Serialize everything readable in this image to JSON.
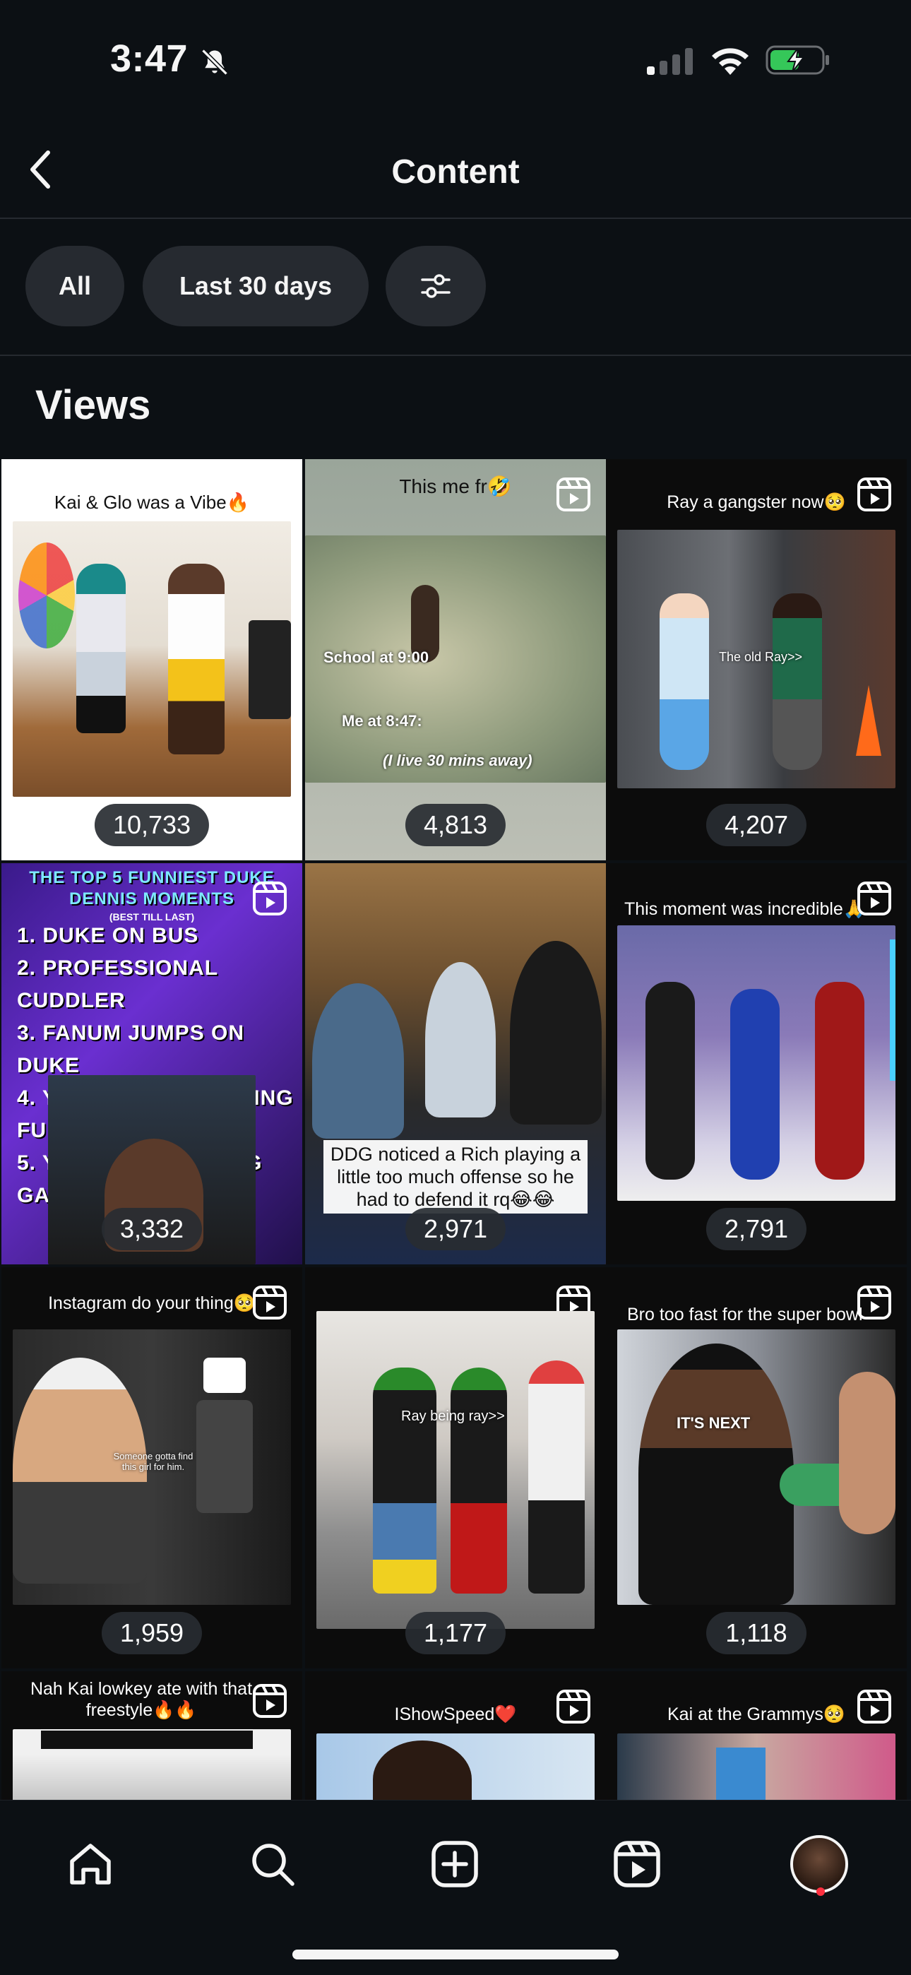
{
  "status_bar": {
    "time": "3:47",
    "icons": [
      "bell-slash-icon",
      "cellular-signal-icon",
      "wifi-icon",
      "battery-charging-icon"
    ]
  },
  "header": {
    "title": "Content",
    "back_icon": "chevron-left-icon"
  },
  "filters": {
    "chips": [
      "All",
      "Last 30 days"
    ],
    "settings_icon": "sliders-icon"
  },
  "section": {
    "title": "Views"
  },
  "grid": {
    "tiles": [
      {
        "caption": "Kai & Glo was a Vibe🔥",
        "views": "10,733",
        "is_reel": false
      },
      {
        "caption": "This me fr🤣",
        "views": "4,813",
        "is_reel": true,
        "overlays": [
          "School at 9:00",
          "Me at 8:47:",
          "(I live 30 mins away)"
        ]
      },
      {
        "caption": "Ray a gangster now🥺",
        "views": "4,207",
        "is_reel": true,
        "overlays": [
          "The old Ray>>"
        ]
      },
      {
        "caption": "",
        "views": "3,332",
        "is_reel": true,
        "title": "THE TOP 5 FUNNIEST DUKE DENNIS MOMENTS",
        "subtitle": "(BEST TILL LAST)",
        "list": [
          "1. DUKE ON BUS",
          "2. PROFESSIONAL CUDDLER",
          "3. FANUM JUMPS ON DUKE",
          "4. YOU ALWAYS GETTING FULL",
          "5. YOUR TRASH GANG GANG"
        ]
      },
      {
        "caption": "DDG noticed a Rich playing a little too much offense so he had to defend it rq😂😂",
        "views": "2,971",
        "is_reel": true
      },
      {
        "caption": "This moment was incredible🙏",
        "views": "2,791",
        "is_reel": true
      },
      {
        "caption": "Instagram do your thing🥺",
        "views": "1,959",
        "is_reel": true,
        "overlays": [
          "Someone gotta find this girl for him."
        ]
      },
      {
        "caption": "",
        "views": "1,177",
        "is_reel": true,
        "overlays": [
          "Ray being ray>>"
        ]
      },
      {
        "caption": "Bro too fast for the super bowl",
        "views": "1,118",
        "is_reel": true,
        "overlays": [
          "IT'S NEXT"
        ]
      },
      {
        "caption": "Nah Kai lowkey ate with that freestyle🔥🔥",
        "views": "",
        "is_reel": true
      },
      {
        "caption": "IShowSpeed❤️",
        "views": "",
        "is_reel": true
      },
      {
        "caption": "Kai at the Grammys🥺",
        "views": "",
        "is_reel": true
      }
    ]
  },
  "tab_bar": {
    "tabs": [
      "home-icon",
      "search-icon",
      "create-icon",
      "reels-icon",
      "profile-avatar"
    ]
  },
  "colors": {
    "background": "#0c1014",
    "chip": "#262a30",
    "notification": "#ff3040"
  }
}
